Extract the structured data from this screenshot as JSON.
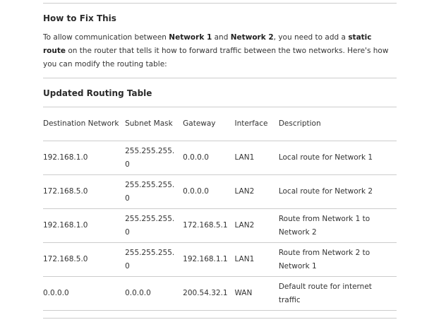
{
  "fix_heading": "How to Fix This",
  "intro": {
    "p1": "To allow communication between ",
    "network1": "Network 1",
    "p2": " and ",
    "network2": "Network 2",
    "p3": ", you need to add a ",
    "static_route": "static route",
    "p4": " on the router that tells it how to forward traffic between the two networks. Here's how you can modify the routing table:"
  },
  "table_heading": "Updated Routing Table",
  "columns": [
    "Destination Network",
    "Subnet Mask",
    "Gateway",
    "Interface",
    "Description"
  ],
  "rows": [
    [
      "192.168.1.0",
      "255.255.255.0",
      "0.0.0.0",
      "LAN1",
      "Local route for Network 1"
    ],
    [
      "172.168.5.0",
      "255.255.255.0",
      "0.0.0.0",
      "LAN2",
      "Local route for Network 2"
    ],
    [
      "192.168.1.0",
      "255.255.255.0",
      "172.168.5.1",
      "LAN2",
      "Route from Network 1 to Network 2"
    ],
    [
      "172.168.5.0",
      "255.255.255.0",
      "192.168.1.1",
      "LAN1",
      "Route from Network 2 to Network 1"
    ],
    [
      "0.0.0.0",
      "0.0.0.0",
      "200.54.32.1",
      "WAN",
      "Default route for internet traffic"
    ]
  ]
}
